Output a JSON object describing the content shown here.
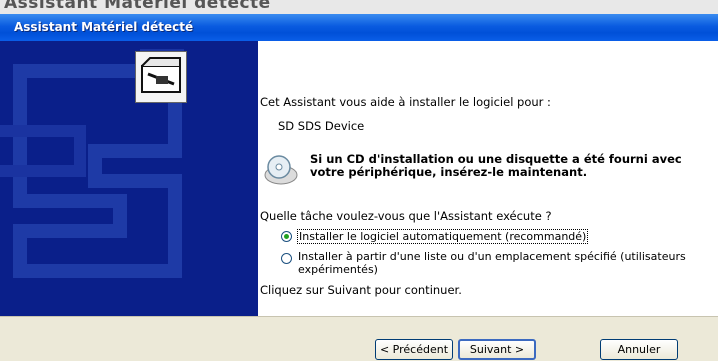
{
  "window": {
    "title": "Assistant Matériel détecté",
    "background_caption": "Assistant Matériel détecté"
  },
  "content": {
    "intro": "Cet Assistant vous aide à installer le logiciel pour :",
    "device_name": "SD SDS Device",
    "cd_notice": "Si un CD d'installation ou une disquette a été fourni avec votre périphérique, insérez-le maintenant.",
    "question": "Quelle tâche voulez-vous que l'Assistant exécute ?",
    "options": [
      {
        "label": "Installer le logiciel automatiquement (recommandé)",
        "selected": true
      },
      {
        "label": "Installer à partir d'une liste ou d'un emplacement spécifié (utilisateurs expérimentés)",
        "selected": false
      }
    ],
    "continue_hint": "Cliquez sur Suivant pour continuer."
  },
  "buttons": {
    "back": "< Précédent",
    "next": "Suivant >",
    "cancel": "Annuler"
  },
  "icons": {
    "wizard": "hardware-box-icon",
    "cd": "cd-disc-icon"
  },
  "colors": {
    "titlebar": "#0a5be0",
    "left_panel": "#0a1f8a",
    "dialog_bg": "#ece9d8"
  }
}
